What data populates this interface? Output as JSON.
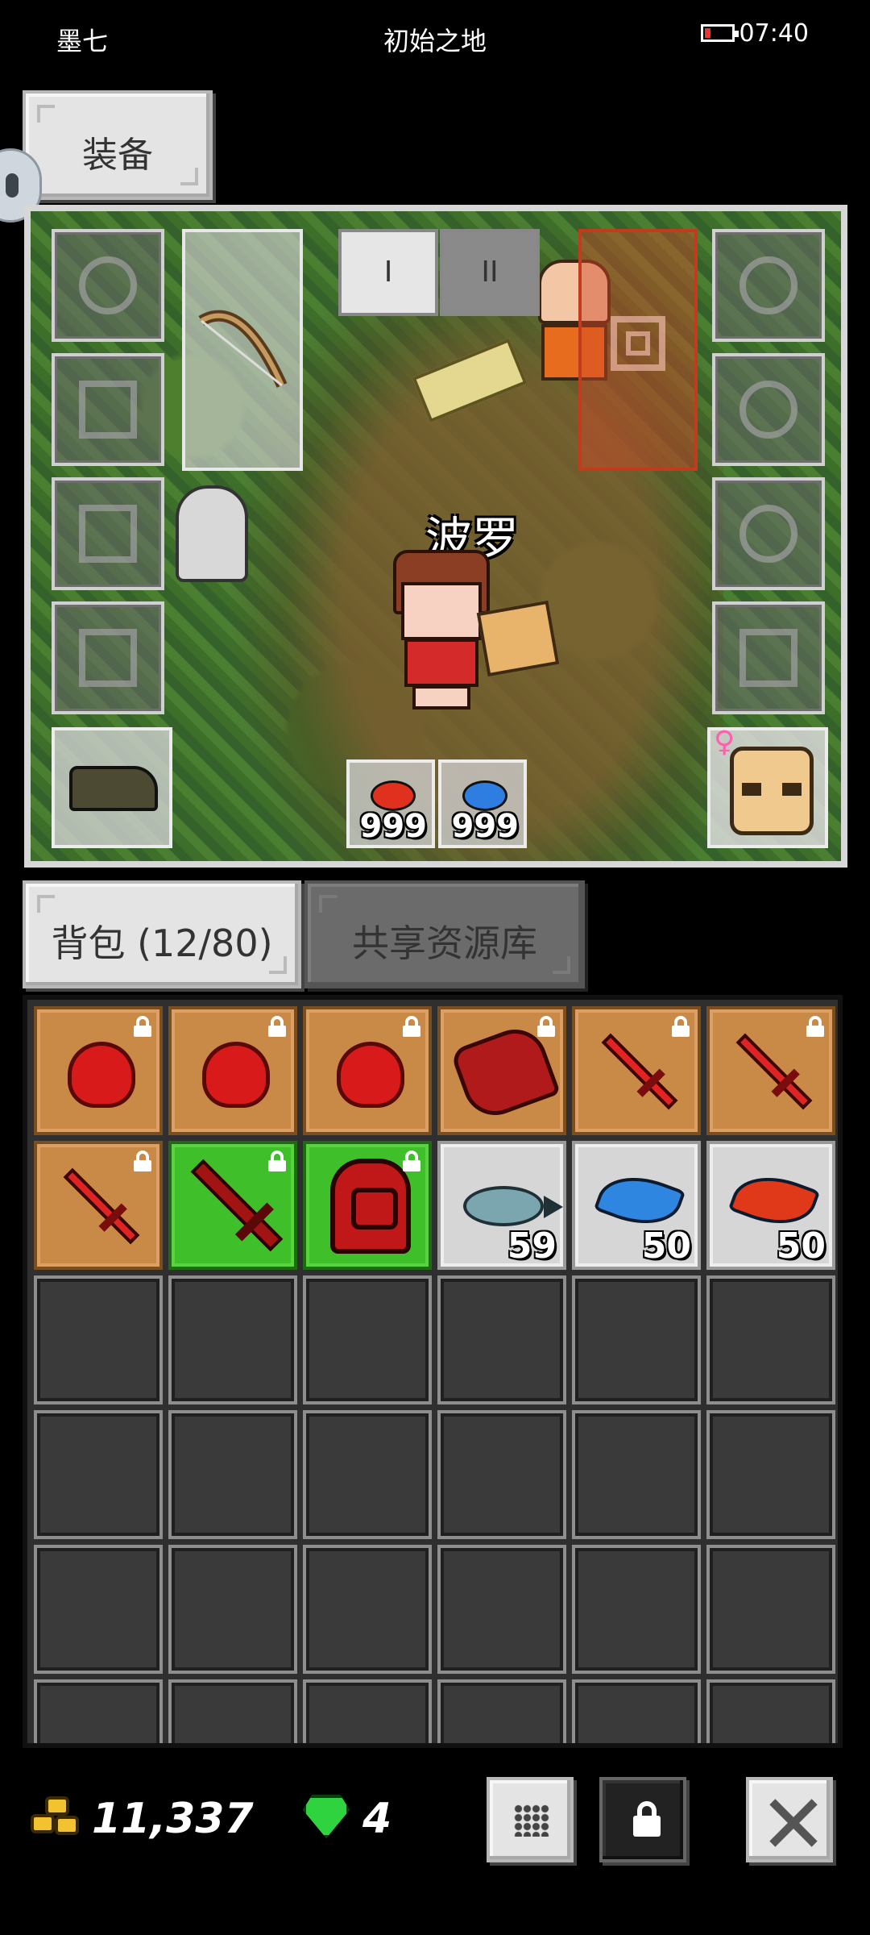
{
  "status_bar": {
    "player_name": "墨七",
    "map_name": "初始之地",
    "time": "07:40",
    "battery_level": 0.2
  },
  "equipment": {
    "tab_label": "装备",
    "page_tabs": [
      "I",
      "II"
    ],
    "active_page": "I",
    "character_name": "波罗",
    "potions": [
      {
        "icon": "red-potion-icon",
        "color": "#e0301e",
        "quantity": "999"
      },
      {
        "icon": "blue-potion-icon",
        "color": "#2d7ee0",
        "quantity": "999"
      }
    ],
    "pet_gender_symbol": "♀"
  },
  "inventory": {
    "tabs": [
      {
        "label": "背包 (12/80)",
        "active": true
      },
      {
        "label": "共享资源库",
        "active": false
      }
    ],
    "items": [
      {
        "icon": "red-slime-icon",
        "rarity": "orange",
        "locked": true,
        "quantity": ""
      },
      {
        "icon": "red-slime-icon",
        "rarity": "orange",
        "locked": true,
        "quantity": ""
      },
      {
        "icon": "red-slime-icon",
        "rarity": "orange",
        "locked": true,
        "quantity": ""
      },
      {
        "icon": "red-glove-icon",
        "rarity": "orange",
        "locked": true,
        "quantity": ""
      },
      {
        "icon": "red-sword-icon",
        "rarity": "orange",
        "locked": true,
        "quantity": ""
      },
      {
        "icon": "red-sword-icon",
        "rarity": "orange",
        "locked": true,
        "quantity": ""
      },
      {
        "icon": "red-sword-icon",
        "rarity": "orange",
        "locked": true,
        "quantity": ""
      },
      {
        "icon": "red-greatsword-icon",
        "rarity": "green",
        "locked": true,
        "quantity": ""
      },
      {
        "icon": "red-helmet-icon",
        "rarity": "green",
        "locked": true,
        "quantity": ""
      },
      {
        "icon": "fish-icon",
        "rarity": "silver",
        "locked": false,
        "quantity": "59"
      },
      {
        "icon": "blue-leaf-icon",
        "rarity": "silver",
        "locked": false,
        "quantity": "50"
      },
      {
        "icon": "red-leaf-icon",
        "rarity": "silver",
        "locked": false,
        "quantity": "50"
      }
    ],
    "visible_empty_slots": 24
  },
  "currency": {
    "gold": "11,337",
    "gems": "4"
  },
  "colors": {
    "rarity_orange": "#c98a48",
    "rarity_green": "#3fbf2a",
    "rarity_silver": "#d6d6d6",
    "empty_slot": "#3a3a3a"
  }
}
